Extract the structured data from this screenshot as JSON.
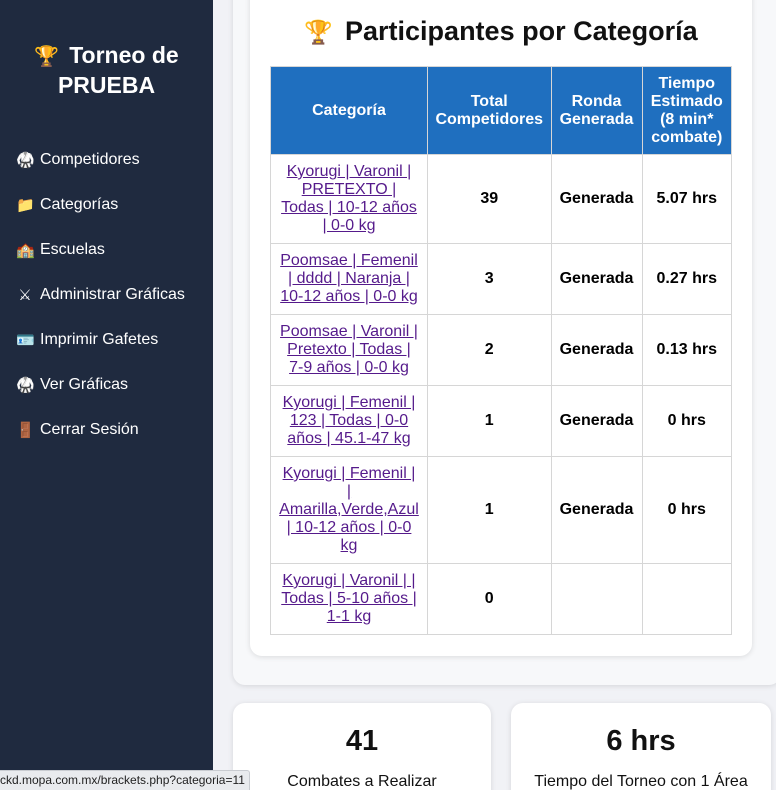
{
  "sidebar": {
    "brand": {
      "icon": "trophy-icon",
      "line1": "Torneo de",
      "line2": "PRUEBA"
    },
    "items": [
      {
        "icon": "uniform-icon",
        "glyph": "🥋",
        "label": "Competidores"
      },
      {
        "icon": "folder-icon",
        "glyph": "📁",
        "label": "Categorías"
      },
      {
        "icon": "school-icon",
        "glyph": "🏫",
        "label": "Escuelas"
      },
      {
        "icon": "crossed-swords-icon",
        "glyph": "⚔",
        "label": "Administrar Gráficas"
      },
      {
        "icon": "id-card-icon",
        "glyph": "🪪",
        "label": "Imprimir Gafetes"
      },
      {
        "icon": "uniform-icon",
        "glyph": "🥋",
        "label": "Ver Gráficas"
      },
      {
        "icon": "door-icon",
        "glyph": "🚪",
        "label": "Cerrar Sesión"
      }
    ]
  },
  "main": {
    "title": "Participantes por Categoría",
    "table": {
      "headers": [
        "Categoría",
        "Total Competidores",
        "Ronda Generada",
        "Tiempo Estimado (8 min* combate)"
      ],
      "rows": [
        {
          "categoria": "Kyorugi | Varonil | PRETEXTO | Todas | 10-12 años | 0-0 kg",
          "total": "39",
          "ronda": "Generada",
          "tiempo": "5.07 hrs"
        },
        {
          "categoria": "Poomsae | Femenil | dddd | Naranja | 10-12 años | 0-0 kg",
          "total": "3",
          "ronda": "Generada",
          "tiempo": "0.27 hrs"
        },
        {
          "categoria": "Poomsae | Varonil | Pretexto | Todas | 7-9 años | 0-0 kg",
          "total": "2",
          "ronda": "Generada",
          "tiempo": "0.13 hrs"
        },
        {
          "categoria": "Kyorugi | Femenil | 123 | Todas | 0-0 años | 45.1-47 kg",
          "total": "1",
          "ronda": "Generada",
          "tiempo": "0 hrs"
        },
        {
          "categoria": "Kyorugi | Femenil | | Amarilla,Verde,Azul | 10-12 años | 0-0 kg",
          "total": "1",
          "ronda": "Generada",
          "tiempo": "0 hrs"
        },
        {
          "categoria": "Kyorugi | Varonil | | Todas | 5-10 años | 1-1 kg",
          "total": "0",
          "ronda": "",
          "tiempo": ""
        }
      ]
    },
    "stats": [
      {
        "value": "41",
        "label": "Combates a Realizar"
      },
      {
        "value": "6 hrs",
        "label": "Tiempo del Torneo con 1 Área"
      }
    ]
  },
  "statusbar": {
    "url": "ckd.mopa.com.mx/brackets.php?categoria=11"
  }
}
